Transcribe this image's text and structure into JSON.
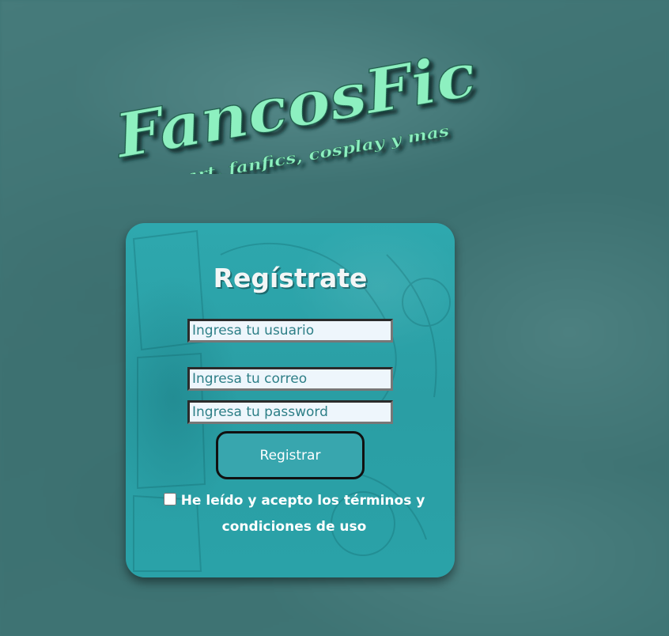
{
  "brand": {
    "name": "FancosFic",
    "tagline": "fanart, fanfics, cosplay y mas"
  },
  "form": {
    "title": "Regístrate",
    "username_placeholder": "Ingresa tu usuario",
    "email_placeholder": "Ingresa tu correo",
    "password_placeholder": "Ingresa tu password",
    "submit_label": "Registrar",
    "terms_label": "He leído y acepto los términos y condiciones de uso",
    "terms_checked": false
  },
  "colors": {
    "background": "#3f7474",
    "card": "#2ea8ae",
    "button": "#38a6ae",
    "logo": "#8df0c0",
    "input_text": "#2e7f87",
    "input_bg": "#eef6fc"
  }
}
